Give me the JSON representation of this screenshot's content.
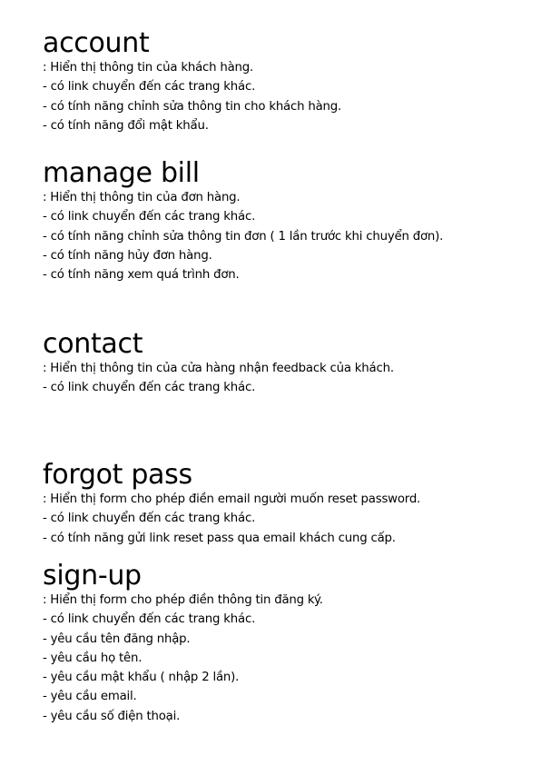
{
  "sections": [
    {
      "title": "account",
      "lines": [
        ": Hiển thị thông tin của khách hàng.",
        "- có link chuyển đến các trang khác.",
        "- có tính năng chỉnh sửa thông tin cho khách hàng.",
        "- có tính năng đổi mật khẩu."
      ]
    },
    {
      "title": "manage bill",
      "lines": [
        ": Hiển thị thông tin của đơn hàng.",
        "- có link chuyển đến các trang khác.",
        "- có tính năng chỉnh sửa thông tin đơn ( 1 lần trước khi chuyển đơn).",
        "- có tính năng hủy đơn hàng.",
        "- có tính năng xem quá trình đơn."
      ]
    },
    {
      "title": "contact",
      "lines": [
        ": Hiển thị thông tin của cửa hàng nhận feedback của khách.",
        "- có link chuyển đến các trang khác."
      ]
    },
    {
      "title": "forgot pass",
      "lines": [
        ": Hiển thị form cho phép điền email người muốn reset password.",
        "- có link chuyển đến các trang khác.",
        "- có tính năng gửi link reset pass qua email khách cung cấp."
      ]
    },
    {
      "title": "sign-up",
      "lines": [
        ": Hiển thị form cho phép điền thông tin đăng ký.",
        "- có link chuyển đến các trang khác.",
        "- yêu cầu tên đăng nhập.",
        "- yêu cầu họ tên.",
        "- yêu cầu mật khẩu ( nhập 2 lần).",
        "- yêu cầu email.",
        "- yêu cầu số điện thoại."
      ]
    }
  ]
}
